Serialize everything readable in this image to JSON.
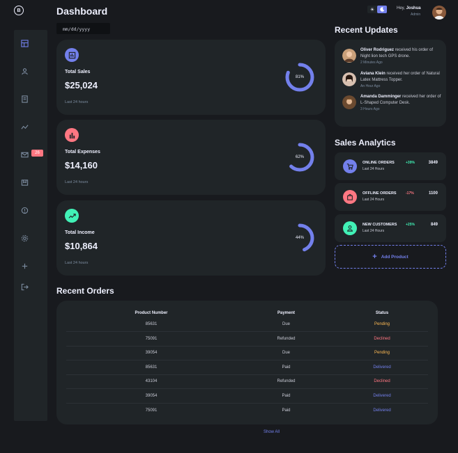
{
  "header": {
    "title": "Dashboard",
    "date_placeholder": "mm/dd/yyyy",
    "greeting": "Hey,",
    "user_name": "Joshua",
    "user_role": "Admin"
  },
  "sidebar": {
    "items": [
      {
        "icon": "grid-icon"
      },
      {
        "icon": "user-icon"
      },
      {
        "icon": "receipt-icon"
      },
      {
        "icon": "analytics-icon"
      },
      {
        "icon": "mail-icon",
        "badge": "26"
      },
      {
        "icon": "inventory-icon"
      },
      {
        "icon": "report-icon"
      },
      {
        "icon": "settings-icon"
      },
      {
        "icon": "add-icon"
      },
      {
        "icon": "logout-icon"
      }
    ]
  },
  "insights": [
    {
      "label": "Total Sales",
      "amount": "$25,024",
      "percent": "81%",
      "fraction": 0.81,
      "note": "Last 24 hours",
      "color": "#7380ec"
    },
    {
      "label": "Total Expenses",
      "amount": "$14,160",
      "percent": "62%",
      "fraction": 0.62,
      "note": "Last 24 hours",
      "color": "#ff7782"
    },
    {
      "label": "Total Income",
      "amount": "$10,864",
      "percent": "44%",
      "fraction": 0.44,
      "note": "Last 24 hours",
      "color": "#41f1b6"
    }
  ],
  "recent_updates": {
    "title": "Recent Updates",
    "items": [
      {
        "name": "Oliver Rodriguez",
        "text": "received his order of Night lion tech GPS drone.",
        "time": "2 Minutes Ago"
      },
      {
        "name": "Aviana Klein",
        "text": "received her order of Natural Latex Mattress Topper.",
        "time": "An Hour Ago"
      },
      {
        "name": "Amanda Damminger",
        "text": "received her order of L-Shaped Computer Desk.",
        "time": "3 Hours Ago"
      }
    ]
  },
  "sales_analytics": {
    "title": "Sales Analytics",
    "items": [
      {
        "title": "ONLINE ORDERS",
        "sub": "Last 24 Hours",
        "pct": "+39%",
        "value": "3849",
        "color": "#7380ec",
        "pct_color": "#41f1b6"
      },
      {
        "title": "OFFLINE ORDERS",
        "sub": "Last 24 Hours",
        "pct": "-17%",
        "value": "1100",
        "color": "#ff7782",
        "pct_color": "#ff7782"
      },
      {
        "title": "NEW CUSTOMERS",
        "sub": "Last 24 Hours",
        "pct": "+25%",
        "value": "849",
        "color": "#41f1b6",
        "pct_color": "#41f1b6"
      }
    ],
    "add_label": "Add Product"
  },
  "recent_orders": {
    "title": "Recent Orders",
    "headers": [
      "Product Number",
      "Payment",
      "Status"
    ],
    "rows": [
      [
        "85631",
        "Due",
        "Pending"
      ],
      [
        "75091",
        "Refunded",
        "Declined"
      ],
      [
        "39054",
        "Due",
        "Pending"
      ],
      [
        "85631",
        "Paid",
        "Delivered"
      ],
      [
        "43104",
        "Refunded",
        "Declined"
      ],
      [
        "39054",
        "Paid",
        "Delivered"
      ],
      [
        "75091",
        "Paid",
        "Delivered"
      ]
    ],
    "status_colors": {
      "Pending": "#ffbb55",
      "Declined": "#ff7782",
      "Delivered": "#7380ec"
    },
    "show_all": "Show All"
  }
}
